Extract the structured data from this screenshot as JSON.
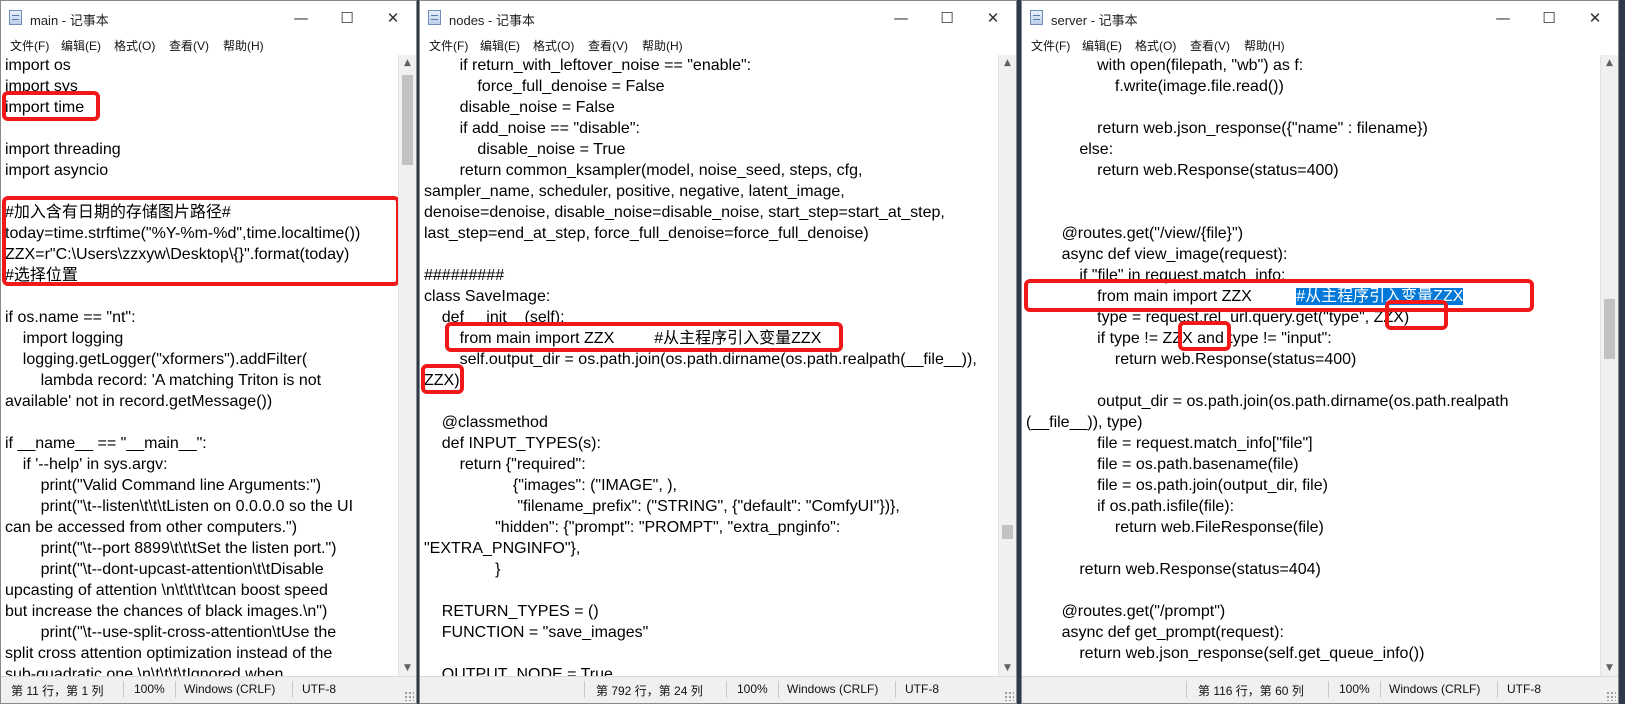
{
  "windows": {
    "main": {
      "title": "main - 记事本",
      "menu": [
        "文件(F)",
        "编辑(E)",
        "格式(O)",
        "查看(V)",
        "帮助(H)"
      ],
      "lines": [
        "import os",
        "import sys",
        "import time",
        "",
        "import threading",
        "import asyncio",
        "",
        "#加入含有日期的存储图片路径#",
        "today=time.strftime(\"%Y-%m-%d\",time.localtime())",
        "ZZX=r\"C:\\Users\\zzxyw\\Desktop\\{}\".format(today)",
        "#选择位置",
        "",
        "if os.name == \"nt\":",
        "    import logging",
        "    logging.getLogger(\"xformers\").addFilter(",
        "        lambda record: 'A matching Triton is not",
        "available' not in record.getMessage())",
        "",
        "if __name__ == \"__main__\":",
        "    if '--help' in sys.argv:",
        "        print(\"Valid Command line Arguments:\")",
        "        print(\"\\t--listen\\t\\t\\tListen on 0.0.0.0 so the UI",
        "can be accessed from other computers.\")",
        "        print(\"\\t--port 8899\\t\\t\\tSet the listen port.\")",
        "        print(\"\\t--dont-upcast-attention\\t\\tDisable",
        "upcasting of attention \\n\\t\\t\\t\\tcan boost speed",
        "but increase the chances of black images.\\n\")",
        "        print(\"\\t--use-split-cross-attention\\tUse the",
        "split cross attention optimization instead of the",
        "sub-quadratic one.\\n\\t\\t\\t\\tIgnored when"
      ],
      "status": {
        "position": "第 11 行，第 1 列",
        "zoom": "100%",
        "eol": "Windows (CRLF)",
        "encoding": "UTF-8"
      }
    },
    "nodes": {
      "title": "nodes - 记事本",
      "menu": [
        "文件(F)",
        "编辑(E)",
        "格式(O)",
        "查看(V)",
        "帮助(H)"
      ],
      "lines": [
        "        if return_with_leftover_noise == \"enable\":",
        "            force_full_denoise = False",
        "        disable_noise = False",
        "        if add_noise == \"disable\":",
        "            disable_noise = True",
        "        return common_ksampler(model, noise_seed, steps, cfg,",
        "sampler_name, scheduler, positive, negative, latent_image,",
        "denoise=denoise, disable_noise=disable_noise, start_step=start_at_step,",
        "last_step=end_at_step, force_full_denoise=force_full_denoise)",
        "",
        "#########",
        "class SaveImage:",
        "    def __init__(self):",
        "        from main import ZZX         #从主程序引入变量ZZX",
        "        self.output_dir = os.path.join(os.path.dirname(os.path.realpath(__file__)),",
        "ZZX)",
        "",
        "    @classmethod",
        "    def INPUT_TYPES(s):",
        "        return {\"required\":",
        "                    {\"images\": (\"IMAGE\", ),",
        "                     \"filename_prefix\": (\"STRING\", {\"default\": \"ComfyUI\"})},",
        "                \"hidden\": {\"prompt\": \"PROMPT\", \"extra_pnginfo\":",
        "\"EXTRA_PNGINFO\"},",
        "                }",
        "",
        "    RETURN_TYPES = ()",
        "    FUNCTION = \"save_images\"",
        "",
        "    OUTPUT_NODE = True"
      ],
      "status": {
        "position": "第 792 行，第 24 列",
        "zoom": "100%",
        "eol": "Windows (CRLF)",
        "encoding": "UTF-8"
      }
    },
    "server": {
      "title": "server - 记事本",
      "menu": [
        "文件(F)",
        "编辑(E)",
        "格式(O)",
        "查看(V)",
        "帮助(H)"
      ],
      "lines": [
        "                with open(filepath, \"wb\") as f:",
        "                    f.write(image.file.read())",
        "",
        "                return web.json_response({\"name\" : filename})",
        "            else:",
        "                return web.Response(status=400)",
        "",
        "",
        "        @routes.get(\"/view/{file}\")",
        "        async def view_image(request):",
        "            if \"file\" in request.match_info:",
        "                from main import ZZX          ",
        "                type = request.rel_url.query.get(\"type\", ZZX)",
        "                if type != ZZX and type != \"input\":",
        "                    return web.Response(status=400)",
        "",
        "                output_dir = os.path.join(os.path.dirname(os.path.realpath",
        "(__file__)), type)",
        "                file = request.match_info[\"file\"]",
        "                file = os.path.basename(file)",
        "                file = os.path.join(output_dir, file)",
        "                if os.path.isfile(file):",
        "                    return web.FileResponse(file)",
        "",
        "            return web.Response(status=404)",
        "",
        "        @routes.get(\"/prompt\")",
        "        async def get_prompt(request):",
        "            return web.json_response(self.get_queue_info())"
      ],
      "selected_comment": "#从主程序引入变量ZZX",
      "status": {
        "position": "第 116 行，第 60 列",
        "zoom": "100%",
        "eol": "Windows (CRLF)",
        "encoding": "UTF-8"
      }
    }
  },
  "colors": {
    "highlight": "#f01818",
    "selection": "#0078d7"
  }
}
